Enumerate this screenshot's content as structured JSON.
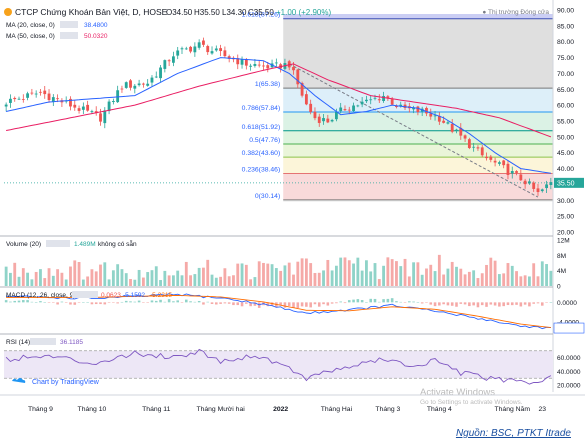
{
  "header": {
    "title": "CTCP Chứng Khoán Bản Việt, D, HOSE",
    "open": "O34.50",
    "high": "H35.50",
    "low": "L34.30",
    "close": "C35.50",
    "change": "+1.00 (+2.90%)",
    "ma20_label": "MA (20, close, 0)",
    "ma20_value": "38.4800",
    "ma50_label": "MA (50, close, 0)",
    "ma50_value": "50.0320",
    "market_status": "Thị trường Đóng cửa"
  },
  "colors": {
    "up": "#26a69a",
    "down": "#ef5350",
    "ma20": "#2962ff",
    "ma50": "#e91e63",
    "macd": "#2962ff",
    "signal": "#ff6d00",
    "rsi": "#7e57c2",
    "rsi_band": "#ede7f6"
  },
  "chart_data": [
    {
      "type": "candlestick",
      "title": "CTCP Chứng Khoán Bản Việt, D, HOSE",
      "ylim": [
        20,
        90
      ],
      "y_ticks": [
        "90.00",
        "85.00",
        "80.00",
        "75.00",
        "70.00",
        "65.00",
        "60.00",
        "55.00",
        "50.00",
        "45.00",
        "40.00",
        "35.00",
        "30.00",
        "25.00",
        "20.00"
      ],
      "last_price_label": "35.50",
      "x_labels": [
        "Tháng 9",
        "Tháng 10",
        "Tháng 11",
        "Tháng Mười hai",
        "2022",
        "Tháng Hai",
        "Tháng 3",
        "Tháng 4",
        "Tháng Năm",
        "23"
      ],
      "x_positions": [
        8,
        20,
        35,
        50,
        64,
        77,
        89,
        101,
        118,
        125
      ],
      "n_candles": 128,
      "anchors": [
        [
          0,
          61
        ],
        [
          8,
          64
        ],
        [
          15,
          60
        ],
        [
          22,
          56
        ],
        [
          27,
          66
        ],
        [
          33,
          67
        ],
        [
          39,
          76
        ],
        [
          45,
          79
        ],
        [
          50,
          76
        ],
        [
          56,
          73
        ],
        [
          62,
          72
        ],
        [
          66,
          73
        ],
        [
          70,
          60
        ],
        [
          72,
          56
        ],
        [
          75,
          55
        ],
        [
          79,
          59
        ],
        [
          84,
          61
        ],
        [
          88,
          63
        ],
        [
          92,
          59
        ],
        [
          97,
          58
        ],
        [
          101,
          56
        ],
        [
          106,
          50
        ],
        [
          111,
          44
        ],
        [
          116,
          40
        ],
        [
          121,
          36
        ],
        [
          124,
          32
        ],
        [
          127,
          35.5
        ]
      ],
      "series": [
        {
          "name": "MA (20, close, 0)",
          "anchors": [
            [
              0,
              58
            ],
            [
              10,
              61
            ],
            [
              20,
              62
            ],
            [
              30,
              63
            ],
            [
              40,
              70
            ],
            [
              50,
              75
            ],
            [
              60,
              74
            ],
            [
              66,
              70
            ],
            [
              72,
              63
            ],
            [
              78,
              57
            ],
            [
              84,
              58
            ],
            [
              90,
              60
            ],
            [
              96,
              59
            ],
            [
              102,
              56
            ],
            [
              108,
              51
            ],
            [
              114,
              45
            ],
            [
              120,
              40
            ],
            [
              127,
              38.5
            ]
          ]
        },
        {
          "name": "MA (50, close, 0)",
          "anchors": [
            [
              0,
              52
            ],
            [
              15,
              56
            ],
            [
              30,
              60
            ],
            [
              45,
              66
            ],
            [
              60,
              71
            ],
            [
              67,
              73
            ],
            [
              75,
              68
            ],
            [
              85,
              63
            ],
            [
              95,
              61
            ],
            [
              105,
              59
            ],
            [
              115,
              56
            ],
            [
              127,
              50
            ]
          ]
        }
      ],
      "fib_levels": [
        {
          "ratio": "1.618(87.26)",
          "value": 87.26
        },
        {
          "ratio": "1(65.38)",
          "value": 65.38
        },
        {
          "ratio": "0.786(57.84)",
          "value": 57.84
        },
        {
          "ratio": "0.618(51.92)",
          "value": 51.92
        },
        {
          "ratio": "0.5(47.76)",
          "value": 47.76
        },
        {
          "ratio": "0.382(43.60)",
          "value": 43.6
        },
        {
          "ratio": "0.236(38.46)",
          "value": 38.46
        },
        {
          "ratio": "0(30.14)",
          "value": 30.14
        }
      ],
      "trend_line": [
        [
          66,
          73
        ],
        [
          124,
          31
        ]
      ]
    },
    {
      "type": "bar",
      "title": "Volume (20)",
      "value_label": "1.489M",
      "note": "không có sẵn",
      "y_ticks": [
        "12M",
        "8M",
        "4M",
        "0"
      ],
      "ylim": [
        0,
        12
      ]
    },
    {
      "type": "line",
      "title": "MACD (12, 26, close, 9)",
      "values_label": [
        "0.0623",
        "-5.1592",
        "-5.2215"
      ],
      "y_ticks": [
        "0.0000",
        "-4.0000"
      ],
      "ylim": [
        -6,
        2.5
      ]
    },
    {
      "type": "line",
      "title": "RSI (14)",
      "value_label": "36.1185",
      "y_ticks": [
        "60.0000",
        "40.0000",
        "20.0000"
      ],
      "ylim": [
        10,
        90
      ],
      "band": [
        30,
        70
      ]
    }
  ],
  "footer": {
    "tradingview": "Chart by TradingView",
    "watermark": "Activate Windows",
    "watermark_sub": "Go to Settings to activate Windows.",
    "source": "Nguồn: BSC, PTKT Itrade"
  }
}
